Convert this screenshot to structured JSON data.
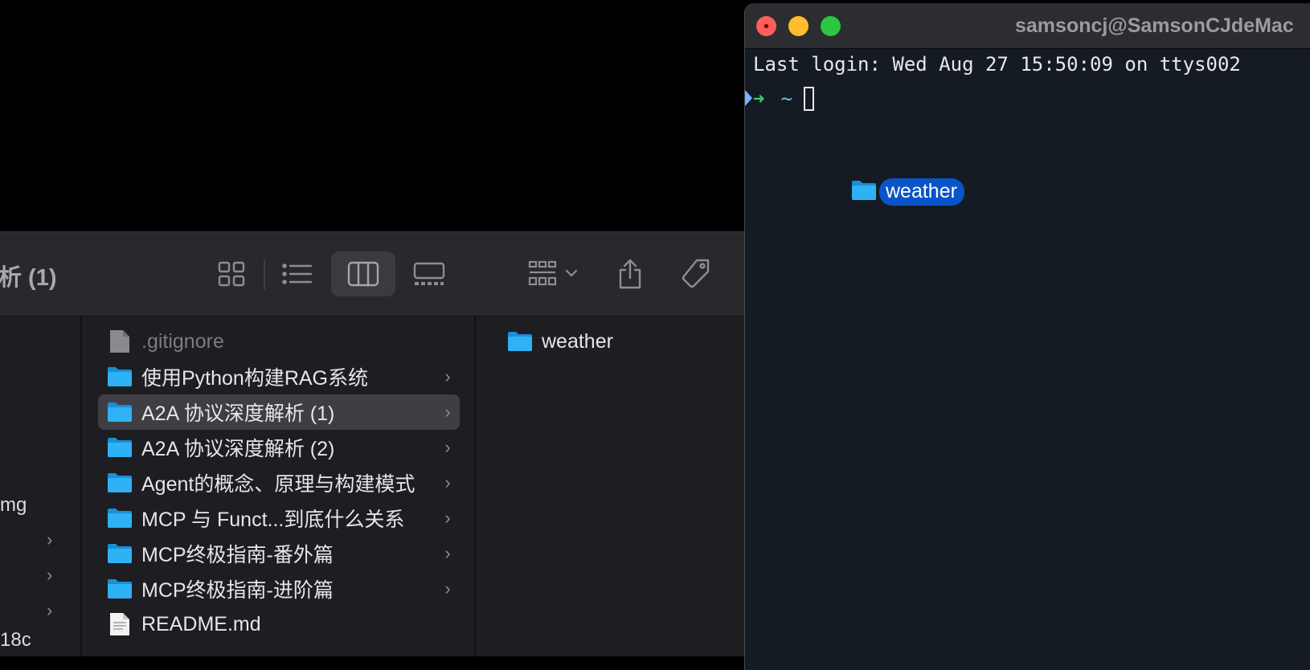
{
  "finder": {
    "title": "析 (1)",
    "toolbar": {
      "view_icons": [
        "grid-view-icon",
        "list-view-icon",
        "column-view-icon",
        "gallery-view-icon"
      ],
      "group_icon": "group-by-icon",
      "share_icon": "share-icon",
      "tag_icon": "tag-icon"
    },
    "col0": {
      "items": [
        "mg",
        "18c"
      ]
    },
    "col1": {
      "items": [
        {
          "label": ".gitignore",
          "type": "file",
          "chevron": ""
        },
        {
          "label": "使用Python构建RAG系统",
          "type": "folder",
          "chevron": "›"
        },
        {
          "label": "A2A 协议深度解析 (1)",
          "type": "folder",
          "chevron": "›",
          "selected": true
        },
        {
          "label": "A2A 协议深度解析 (2)",
          "type": "folder",
          "chevron": "›"
        },
        {
          "label": "Agent的概念、原理与构建模式",
          "type": "folder",
          "chevron": "›"
        },
        {
          "label": "MCP 与 Funct...到底什么关系",
          "type": "folder",
          "chevron": "›"
        },
        {
          "label": "MCP终极指南-番外篇",
          "type": "folder",
          "chevron": "›"
        },
        {
          "label": "MCP终极指南-进阶篇",
          "type": "folder",
          "chevron": "›"
        },
        {
          "label": "README.md",
          "type": "doc",
          "chevron": ""
        }
      ]
    },
    "col2": {
      "items": [
        {
          "label": "weather",
          "type": "folder"
        }
      ]
    },
    "colors": {
      "folder": "#1fa8f0",
      "selection": "#3f3e44"
    }
  },
  "terminal": {
    "title": "samsoncj@SamsonCJdeMac",
    "last_login": "Last login: Wed Aug 27 15:50:09 on ttys002",
    "prompt_arrow": "➜",
    "prompt_dir": "~"
  },
  "drag": {
    "label": "weather",
    "color": "#0a54c9"
  }
}
